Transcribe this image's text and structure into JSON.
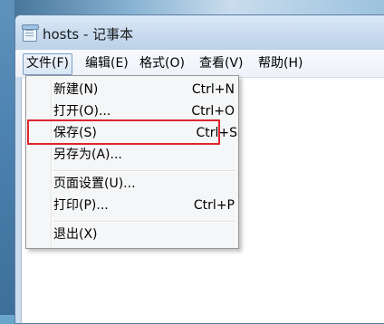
{
  "window": {
    "title": "hosts - 记事本"
  },
  "menubar": {
    "items": [
      {
        "label": "文件(F)"
      },
      {
        "label": "编辑(E)"
      },
      {
        "label": "格式(O)"
      },
      {
        "label": "查看(V)"
      },
      {
        "label": "帮助(H)"
      }
    ]
  },
  "file_menu": {
    "items": [
      {
        "label": "新建(N)",
        "shortcut": "Ctrl+N"
      },
      {
        "label": "打开(O)...",
        "shortcut": "Ctrl+O"
      },
      {
        "label": "保存(S)",
        "shortcut": "Ctrl+S"
      },
      {
        "label": "另存为(A)...",
        "shortcut": ""
      },
      {
        "label": "页面设置(U)...",
        "shortcut": ""
      },
      {
        "label": "打印(P)...",
        "shortcut": "Ctrl+P"
      },
      {
        "label": "退出(X)",
        "shortcut": ""
      }
    ]
  },
  "colors": {
    "highlight_border": "#e0242b",
    "menu_background": "#f5f6f7",
    "titlebar": "#c6d9ee"
  },
  "icons": [
    "notepad-app-icon"
  ]
}
